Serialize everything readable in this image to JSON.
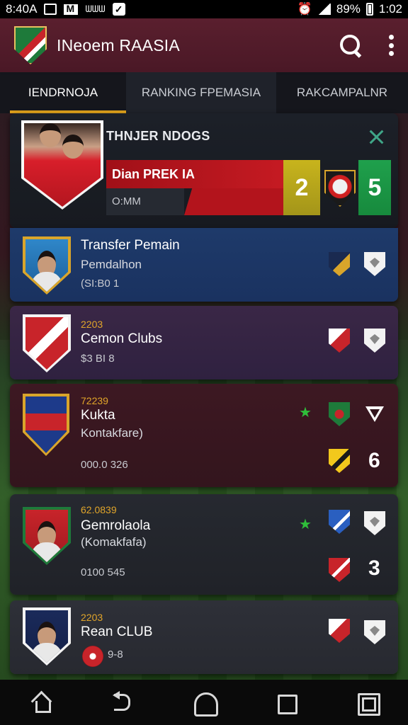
{
  "status_bar": {
    "time_left": "8:40A",
    "mail_text": "M",
    "carrier": "ᗯᗯᗯ",
    "battery": "89%",
    "time_right": "1:02"
  },
  "app_bar": {
    "title": "INeoem RAASIA"
  },
  "tabs": [
    {
      "label": "IENDRNOJA",
      "active": true
    },
    {
      "label": "RANKING FPEMASIA",
      "active": false
    },
    {
      "label": "RAKCAMPALNR",
      "active": false
    }
  ],
  "featured": {
    "title": "THNJER NDOGS",
    "match_name": "Dian PREK IA",
    "match_sub": "O:MM",
    "score_home": "2",
    "score_away": "5"
  },
  "list": [
    {
      "code": "",
      "name": "Transfer Pemain",
      "sub": "Pemdalhon",
      "meta": "(SI:B0 1",
      "right_value": ""
    },
    {
      "code": "2203",
      "name": "Cemon Clubs",
      "sub": "",
      "meta": "$3 BI 8",
      "right_value": ""
    },
    {
      "code": "72239",
      "name": "Kukta",
      "sub": "Kontakfare)",
      "meta": "000.0 326",
      "right_value": "6"
    },
    {
      "code": "62.0839",
      "name": "Gemrolaola",
      "sub": "(Komakfafa)",
      "meta": "0100 545",
      "right_value": "3"
    },
    {
      "code": "2203",
      "name": "Rean CLUB",
      "sub": "",
      "meta": "9-8",
      "right_value": ""
    }
  ],
  "colors": {
    "app_bar": "#4e1a28",
    "accent": "#e0a21c",
    "score_yellow": "#c8b41c",
    "score_green": "#1fa04c",
    "star_green": "#2fbf3a"
  }
}
